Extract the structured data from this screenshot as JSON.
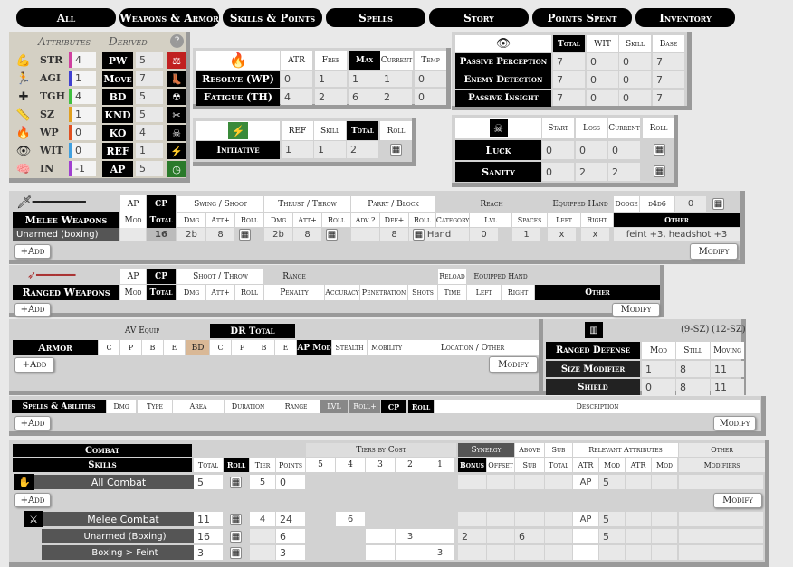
{
  "tabs": [
    "All",
    "Weapons & Armor",
    "Skills & Points",
    "Spells",
    "Story",
    "Points Spent",
    "Inventory"
  ],
  "attributes": {
    "title_attr": "Attributes",
    "title_derived": "Derived",
    "help": "?",
    "rows": [
      {
        "name": "STR",
        "val": "4",
        "dname": "PW",
        "dval": "5"
      },
      {
        "name": "AGI",
        "val": "1",
        "dname": "Move",
        "dval": "7"
      },
      {
        "name": "TGH",
        "val": "4",
        "dname": "BD",
        "dval": "5"
      },
      {
        "name": "SZ",
        "val": "1",
        "dname": "KND",
        "dval": "5"
      },
      {
        "name": "WP",
        "val": "0",
        "dname": "KO",
        "dval": "4"
      },
      {
        "name": "WIT",
        "val": "0",
        "dname": "REF",
        "dval": "1"
      },
      {
        "name": "IN",
        "val": "-1",
        "dname": "AP",
        "dval": "5"
      }
    ]
  },
  "resolve": {
    "cols": [
      "ATR",
      "Free",
      "Max",
      "Current",
      "Temp"
    ],
    "rows": [
      {
        "name": "Resolve (WP)",
        "vals": [
          "0",
          "1",
          "1",
          "1",
          "0"
        ]
      },
      {
        "name": "Fatigue (TH)",
        "vals": [
          "4",
          "2",
          "6",
          "2",
          "0"
        ]
      }
    ]
  },
  "passive": {
    "cols": [
      "Total",
      "WIT",
      "Skill",
      "Base"
    ],
    "rows": [
      {
        "name": "Passive Perception",
        "vals": [
          "7",
          "0",
          "0",
          "7"
        ]
      },
      {
        "name": "Enemy Detection",
        "vals": [
          "7",
          "0",
          "0",
          "7"
        ]
      },
      {
        "name": "Passive Insight",
        "vals": [
          "7",
          "0",
          "0",
          "7"
        ]
      }
    ]
  },
  "initiative": {
    "cols": [
      "REF",
      "Skill",
      "Total",
      "Roll"
    ],
    "name": "Initiative",
    "vals": [
      "1",
      "1",
      "2"
    ]
  },
  "luck": {
    "cols": [
      "Start",
      "Loss",
      "Current",
      "Roll"
    ],
    "rows": [
      {
        "name": "Luck",
        "vals": [
          "0",
          "0",
          "0"
        ]
      },
      {
        "name": "Sanity",
        "vals": [
          "0",
          "2",
          "2"
        ]
      }
    ]
  },
  "melee": {
    "title": "Melee Weapons",
    "ap": "AP",
    "cp": "CP",
    "mod": "Mod",
    "total": "Total",
    "swing": "Swing / Shoot",
    "thrust": "Thrust / Throw",
    "parry": "Parry / Block",
    "reach": "Reach",
    "equipped": "Equipped Hand",
    "dodge": "Dodge",
    "dodge_dice": "d4d6",
    "dodge_val": "0",
    "sub": [
      "Dmg",
      "Att+",
      "Roll",
      "Dmg",
      "Att+",
      "Roll",
      "Adv.?",
      "Def+",
      "Roll",
      "Category",
      "Lvl",
      "Spaces",
      "Left",
      "Right",
      "Other"
    ],
    "row": {
      "name": "Unarmed (boxing)",
      "total": "16",
      "sdmg": "2b",
      "satt": "8",
      "tdmg": "2b",
      "tatt": "8",
      "def": "8",
      "cat": "Hand",
      "lvl": "0",
      "spaces": "1",
      "left": "x",
      "right": "x",
      "other": "feint +3, headshot +3"
    },
    "add": "+Add",
    "modify": "Modify"
  },
  "ranged": {
    "title": "Ranged Weapons",
    "ap": "AP",
    "cp": "CP",
    "mod": "Mod",
    "total": "Total",
    "shoot": "Shoot / Throw",
    "range": "Range",
    "penalty": "Penalty",
    "sub": [
      "Dmg",
      "Att+",
      "Roll"
    ],
    "cols": [
      "Accuracy",
      "Penetration",
      "Shots"
    ],
    "reload": "Reload",
    "time": "Time",
    "equipped": "Equipped Hand",
    "left": "Left",
    "right": "Right",
    "other": "Other",
    "add": "+Add",
    "modify": "Modify"
  },
  "armor": {
    "title": "Armor",
    "av": "AV Equip",
    "dr": "DR Total",
    "av_cols": [
      "C",
      "P",
      "B",
      "E"
    ],
    "bd": "BD",
    "dr_cols": [
      "C",
      "P",
      "B",
      "E"
    ],
    "apmod": "AP Mod",
    "stealth": "Stealth",
    "mobility": "Mobility",
    "location": "Location / Other",
    "add": "+Add",
    "modify": "Modify"
  },
  "rdef": {
    "sz1": "(9-SZ)",
    "sz2": "(12-SZ)",
    "title": "Ranged Defense",
    "cols": [
      "Mod",
      "Still",
      "Moving"
    ],
    "rows": [
      {
        "name": "Size Modifier",
        "vals": [
          "1",
          "8",
          "11"
        ]
      },
      {
        "name": "Shield",
        "vals": [
          "0",
          "8",
          "11"
        ]
      }
    ]
  },
  "spells": {
    "title": "Spells & Abilities",
    "cols": [
      "Dmg",
      "Type",
      "Area",
      "Duration",
      "Range",
      "LVL",
      "Roll+",
      "CP",
      "Roll",
      "Description"
    ],
    "add": "+Add",
    "modify": "Modify"
  },
  "combat": {
    "title1": "Combat",
    "title2": "Skills",
    "total": "Total",
    "roll": "Roll",
    "tier": "Tier",
    "points": "Points",
    "tiers_by_cost": "Tiers by Cost",
    "tier_nums": [
      "5",
      "4",
      "3",
      "2",
      "1"
    ],
    "synergy": "Synergy",
    "bonus": "Bonus",
    "offset": "Offset",
    "above": "Above",
    "sub": "Sub",
    "sub2": "Sub",
    "total2": "Total",
    "relevant": "Relevant Attributes",
    "atr": "ATR",
    "mod": "Mod",
    "other": "Other",
    "modifiers": "Modifiers",
    "add": "+Add",
    "modify": "Modify",
    "rows": [
      {
        "name": "All Combat",
        "total": "5",
        "tier": "5",
        "points": "0",
        "atr": "AP",
        "mod": "5"
      },
      {
        "name": "Melee Combat",
        "total": "11",
        "tier": "4",
        "points": "24",
        "t4": "6",
        "atr": "AP",
        "mod": "5"
      },
      {
        "name": "Unarmed (Boxing)",
        "total": "16",
        "points": "6",
        "t2": "3",
        "bonus": "2",
        "above": "6",
        "mod": "5"
      },
      {
        "name": "Boxing > Feint",
        "total": "3",
        "points": "3",
        "t1": "3"
      }
    ]
  }
}
